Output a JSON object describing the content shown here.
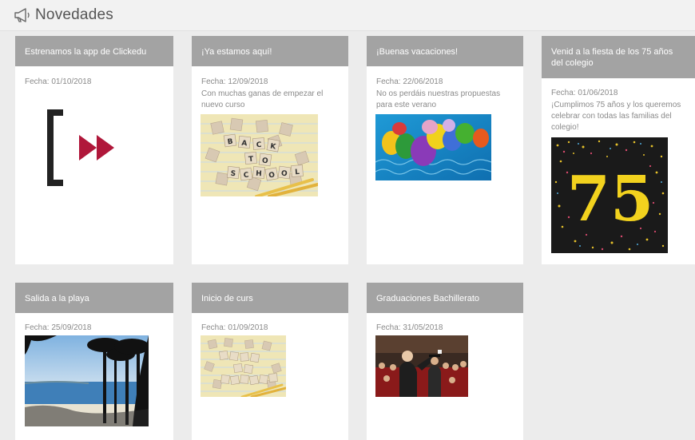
{
  "header": {
    "title": "Novedades",
    "icon": "megaphone-icon"
  },
  "cards": [
    {
      "title": "Estrenamos la app de Clickedu",
      "date": "Fecha: 01/10/2018",
      "desc": ""
    },
    {
      "title": "¡Ya estamos aquí!",
      "date": "Fecha: 12/09/2018",
      "desc": "Con muchas ganas de empezar el nuevo curso"
    },
    {
      "title": "¡Buenas vacaciones!",
      "date": "Fecha: 22/06/2018",
      "desc": "No os perdáis nuestras propuestas para este verano"
    },
    {
      "title": "Venid a la fiesta de los 75 años del colegio",
      "date": "Fecha: 01/06/2018",
      "desc": "¡Cumplimos 75 años y los queremos celebrar con todas las familias del colegio!"
    },
    {
      "title": "Salida a la playa",
      "date": "Fecha: 25/09/2018",
      "desc": ""
    },
    {
      "title": "Inicio de curs",
      "date": "Fecha: 01/09/2018",
      "desc": ""
    },
    {
      "title": "Graduaciones Bachillerato",
      "date": "Fecha: 31/05/2018",
      "desc": ""
    }
  ],
  "images": {
    "back_to_school_tiles": [
      "B",
      "A",
      "C",
      "K",
      "T",
      "O",
      "S",
      "C",
      "H",
      "O",
      "O",
      "L"
    ],
    "anniversary_number": "75"
  },
  "colors": {
    "header_bar": "#a3a3a3",
    "card_bg": "#ffffff",
    "page_bg": "#ececec",
    "brand_red": "#b0173a"
  }
}
